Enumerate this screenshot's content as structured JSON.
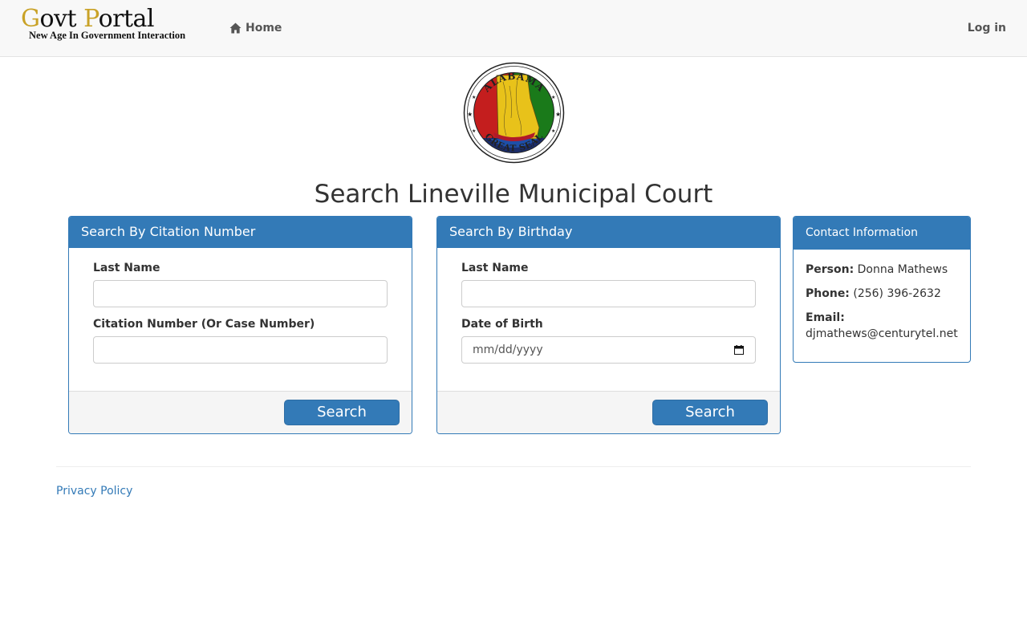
{
  "brand": {
    "title_first_letter": "G",
    "title_rest_1": "ovt ",
    "title_second_letter": "P",
    "title_rest_2": "ortal",
    "subtitle": "New Age In Government Interaction"
  },
  "nav": {
    "home_label": "Home",
    "login_label": "Log in"
  },
  "seal": {
    "top_text": "ALABAMA",
    "bottom_text": "GREAT SEAL"
  },
  "page": {
    "title": "Search Lineville Municipal Court"
  },
  "citation_panel": {
    "heading": "Search By Citation Number",
    "last_name_label": "Last Name",
    "last_name_value": "",
    "citation_label": "Citation Number (Or Case Number)",
    "citation_value": "",
    "search_button": "Search"
  },
  "birthday_panel": {
    "heading": "Search By Birthday",
    "last_name_label": "Last Name",
    "last_name_value": "",
    "dob_label": "Date of Birth",
    "dob_placeholder": "mm/dd/yyyy",
    "search_button": "Search"
  },
  "contact": {
    "heading": "Contact Information",
    "person_label": "Person:",
    "person_value": "Donna Mathews",
    "phone_label": "Phone:",
    "phone_value": "(256) 396-2632",
    "email_label": "Email:",
    "email_value": "djmathews@centurytel.net"
  },
  "footer": {
    "privacy_label": "Privacy Policy"
  },
  "colors": {
    "primary": "#337ab7",
    "brand_accent": "#c9a227",
    "navbar_bg": "#f8f8f8"
  }
}
